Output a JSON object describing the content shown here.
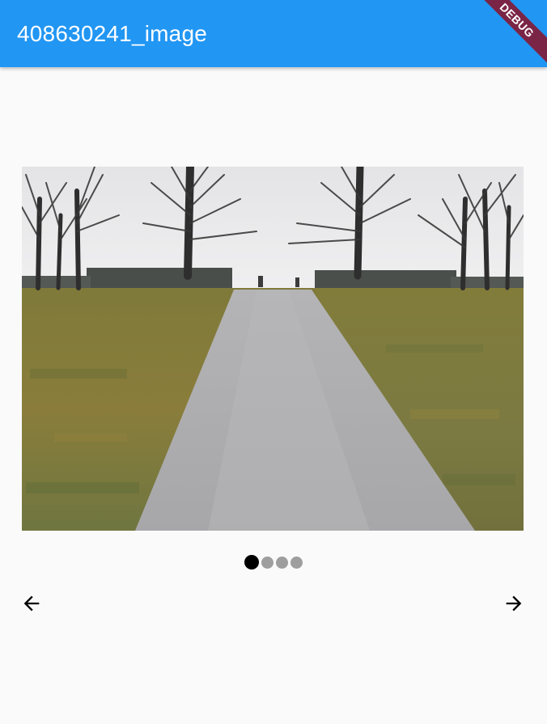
{
  "appbar": {
    "title": "408630241_image",
    "background_color": "#2196f3",
    "debug_banner": "DEBUG",
    "debug_banner_color": "#7b2546"
  },
  "carousel": {
    "image_alt": "Gravel path between grass fields leading to bare trees",
    "slide_count": 4,
    "active_index": 0,
    "indicator_active_color": "#000000",
    "indicator_inactive_color": "#9e9e9e"
  },
  "navigation": {
    "prev_icon": "arrow-back-icon",
    "next_icon": "arrow-forward-icon"
  }
}
